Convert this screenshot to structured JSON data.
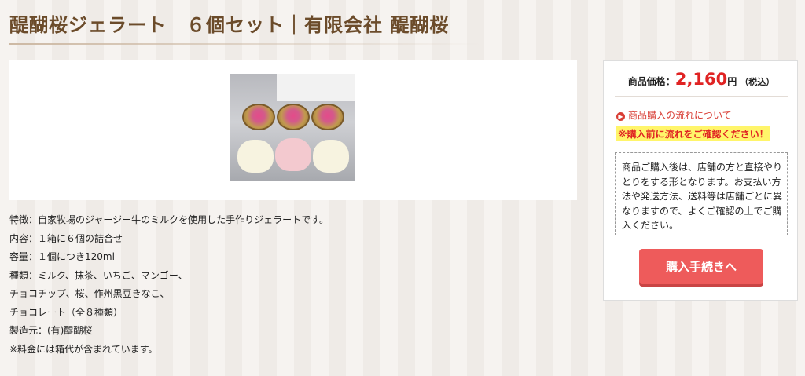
{
  "page": {
    "title": "醍醐桜ジェラート　６個セット｜有限会社 醍醐桜"
  },
  "product": {
    "image_name": "gelato-cups-photo",
    "description_lines": [
      "特徴：自家牧場のジャージー牛のミルクを使用した手作りジェラートです。",
      "内容：１箱に６個の詰合せ",
      "容量：１個につき120ml",
      "種類：ミルク、抹茶、いちご、マンゴー、",
      "チョコチップ、桜、作州黒豆きなこ、",
      "チョコレート（全８種類）",
      "製造元：(有)醍醐桜",
      "※料金には箱代が含まれています。"
    ]
  },
  "sidebar": {
    "price_label": "商品価格：",
    "price_value": "2,160",
    "price_unit": "円",
    "price_tax": "（税込）",
    "flow_link": "商品購入の流れについて",
    "warning": "※購入前に流れをご確認ください！",
    "notice": "商品ご購入後は、店舗の方と直接やりとりをする形となります。お支払い方法や発送方法、送料等は店舗ごとに異なりますので、よくご確認の上でご購入ください。",
    "buy_button": "購入手続きへ"
  },
  "colors": {
    "title": "#6b4b2a",
    "price": "#e02323",
    "button": "#ee5b5b",
    "warning_bg": "#fff56a"
  }
}
